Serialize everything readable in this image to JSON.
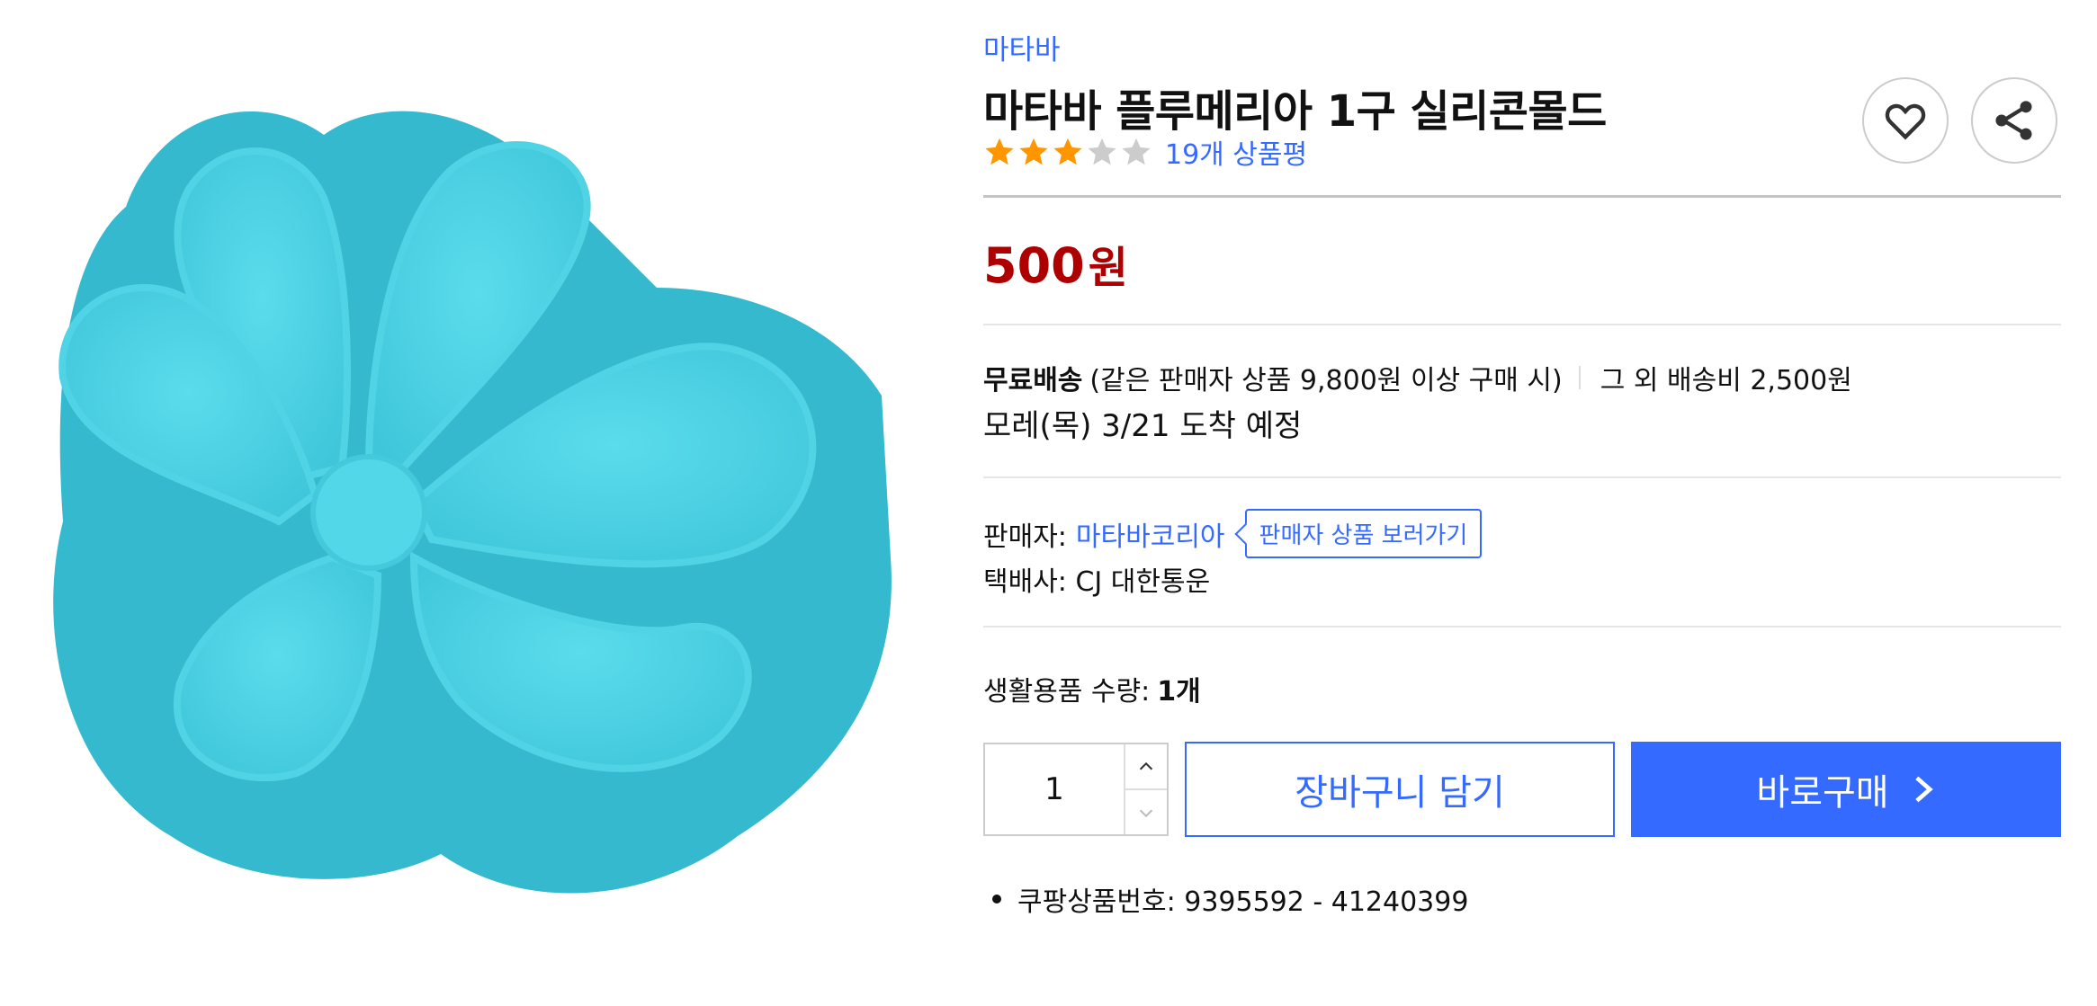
{
  "product": {
    "brand": "마타바",
    "title": "마타바 플루메리아 1구 실리콘몰드",
    "rating": 3,
    "rating_max": 5,
    "review_count_text": "19개 상품평",
    "image_color": "#45cde0"
  },
  "price": {
    "amount": "500",
    "unit": "원"
  },
  "shipping": {
    "free_label": "무료배송",
    "condition": "(같은 판매자 상품 9,800원 이상 구매 시)",
    "other_fee": "그 외 배송비 2,500원",
    "arrival": "모레(목) 3/21 도착 예정"
  },
  "seller": {
    "label": "판매자:",
    "name": "마타바코리아",
    "link_label": "판매자 상품 보러가기",
    "courier": "택배사: CJ 대한통운"
  },
  "quantity": {
    "label": "생활용품 수량:",
    "label_value": "1개",
    "value": "1"
  },
  "actions": {
    "cart": "장바구니 담기",
    "buy": "바로구매"
  },
  "product_number": "쿠팡상품번호: 9395592 - 41240399",
  "colors": {
    "accent": "#346aff",
    "price": "#ae0000",
    "star_on": "#ff9600",
    "star_off": "#cccccc"
  },
  "icons": {
    "wishlist": "heart-icon",
    "share": "share-icon",
    "qty_up": "chevron-up-icon",
    "qty_down": "chevron-down-icon",
    "buy": "chevron-right-icon"
  }
}
